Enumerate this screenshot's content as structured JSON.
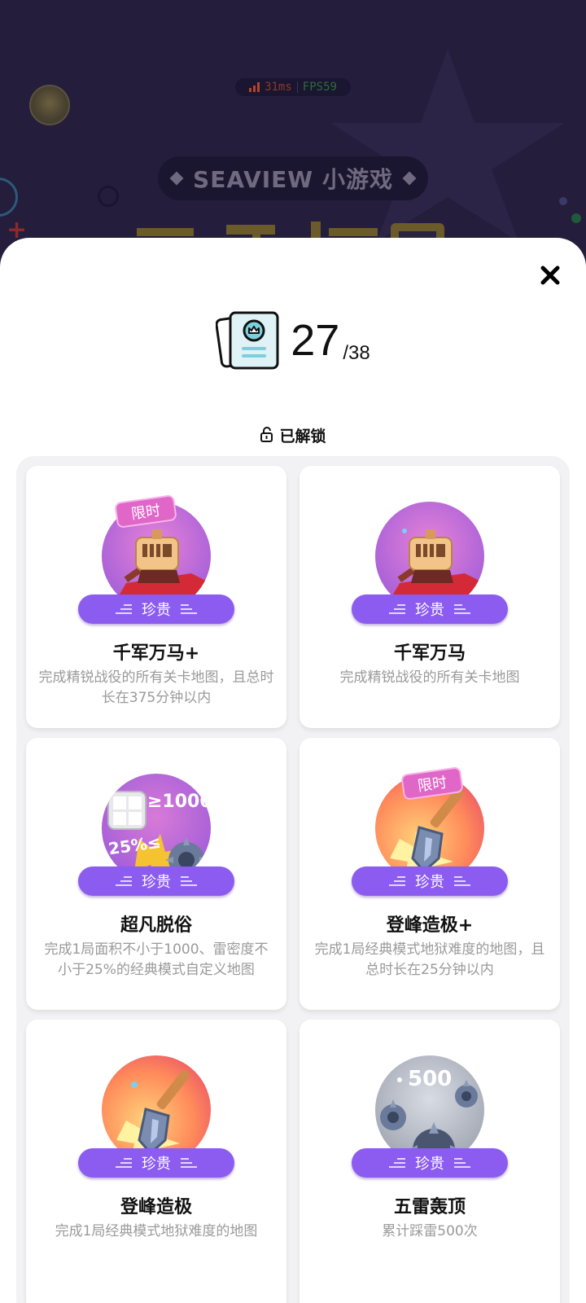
{
  "background": {
    "perf_ms": "31ms",
    "perf_fps": "FPS59",
    "game_label": "SEAVIEW 小游戏"
  },
  "summary": {
    "unlocked_count": "27",
    "total": "/38"
  },
  "filter": {
    "label": "已解锁"
  },
  "achievements": [
    {
      "title": "千军万马+",
      "desc": "完成精锐战役的所有关卡地图，且总时长在375分钟以内",
      "rarity": "珍贵",
      "tag": "限时",
      "icon": "knight-badge-icon"
    },
    {
      "title": "千军万马",
      "desc": "完成精锐战役的所有关卡地图",
      "rarity": "珍贵",
      "tag": "",
      "icon": "knight-badge-icon"
    },
    {
      "title": "超凡脱俗",
      "desc": "完成1局面积不小于1000、雷密度不小于25%的经典模式自定义地图",
      "rarity": "珍贵",
      "tag": "",
      "icon": "mine-density-badge-icon",
      "badge_text_1": "≥1000",
      "badge_text_2": "25%≤"
    },
    {
      "title": "登峰造极+",
      "desc": "完成1局经典模式地狱难度的地图，且总时长在25分钟以内",
      "rarity": "珍贵",
      "tag": "限时",
      "icon": "shovel-badge-icon"
    },
    {
      "title": "登峰造极",
      "desc": "完成1局经典模式地狱难度的地图",
      "rarity": "珍贵",
      "tag": "",
      "icon": "shovel-badge-icon"
    },
    {
      "title": "五雷轰顶",
      "desc": "累计踩雷500次",
      "rarity": "珍贵",
      "tag": "",
      "icon": "mines-500-badge-icon",
      "badge_text_1": "500"
    }
  ],
  "colors": {
    "rarity_purple": "#8c5cf0",
    "sheet_bg": "#ffffff",
    "grid_bg": "#f2f2f4"
  }
}
